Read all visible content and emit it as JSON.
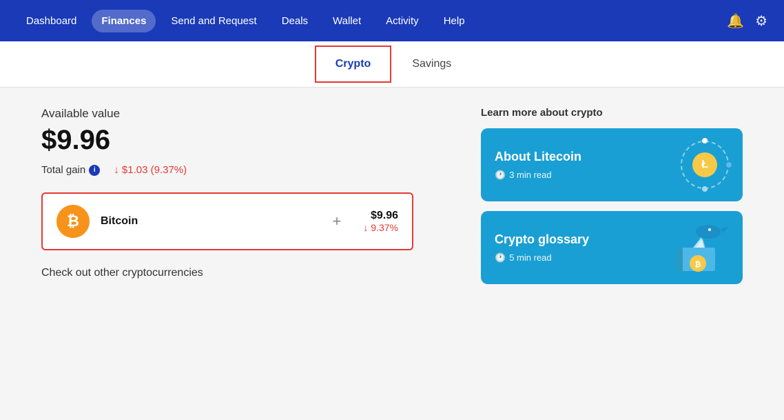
{
  "nav": {
    "items": [
      {
        "label": "Dashboard",
        "active": false
      },
      {
        "label": "Finances",
        "active": true
      },
      {
        "label": "Send and Request",
        "active": false
      },
      {
        "label": "Deals",
        "active": false
      },
      {
        "label": "Wallet",
        "active": false
      },
      {
        "label": "Activity",
        "active": false
      },
      {
        "label": "Help",
        "active": false
      }
    ]
  },
  "sub_tabs": [
    {
      "label": "Crypto",
      "active": true
    },
    {
      "label": "Savings",
      "active": false
    }
  ],
  "main": {
    "available_value_label": "Available value",
    "available_value_amount": "$9.96",
    "total_gain_label": "Total gain",
    "total_gain_value": "↓ $1.03 (9.37%)",
    "bitcoin_card": {
      "name": "Bitcoin",
      "usd_value": "$9.96",
      "pct_change": "↓ 9.37%"
    },
    "check_other_label": "Check out other cryptocurrencies"
  },
  "right_panel": {
    "learn_label": "Learn more about crypto",
    "cards": [
      {
        "title": "About Litecoin",
        "time_label": "3 min read",
        "type": "litecoin"
      },
      {
        "title": "Crypto glossary",
        "time_label": "5 min read",
        "type": "glossary"
      }
    ]
  }
}
